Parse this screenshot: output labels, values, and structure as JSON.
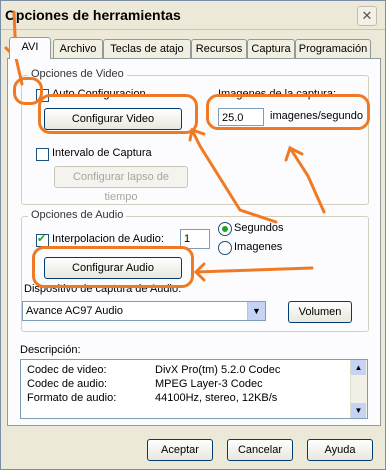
{
  "window": {
    "title": "Opciones de herramientas",
    "close_glyph": "✕"
  },
  "tabs": [
    "AVI",
    "Archivo",
    "Teclas de atajo",
    "Recursos",
    "Captura",
    "Programación"
  ],
  "video_group": {
    "title": "Opciones de Video",
    "auto_config_label": "Auto Configuracion",
    "configure_video_button": "Configurar Video",
    "captura_images_label": "Imagenes de la captura:",
    "fps_value": "25.0",
    "fps_unit": "imagenes/segundo",
    "interval_label": "Intervalo de Captura",
    "interval_button": "Configurar lapso de tiempo"
  },
  "audio_group": {
    "title": "Opciones de Audio",
    "interpolation_label": "Interpolacion de Audio:",
    "interpolation_value": "1",
    "radio_seconds": "Segundos",
    "radio_images": "Imagenes",
    "configure_audio_button": "Configurar Audio",
    "device_label": "Dispositivo de captura de Audio:",
    "device_selected": "Avance AC97 Audio",
    "volume_button": "Volumen"
  },
  "description": {
    "title": "Descripción:",
    "rows": [
      {
        "label": "Codec de video:",
        "value": "DivX Pro(tm) 5.2.0 Codec"
      },
      {
        "label": "Codec de audio:",
        "value": "MPEG Layer-3 Codec"
      },
      {
        "label": "Formato de audio:",
        "value": "44100Hz, stereo, 12KB/s"
      }
    ]
  },
  "footer": {
    "accept": "Aceptar",
    "cancel": "Cancelar",
    "help": "Ayuda"
  },
  "colors": {
    "annotation": "#f07a24",
    "check": "#21a121"
  }
}
